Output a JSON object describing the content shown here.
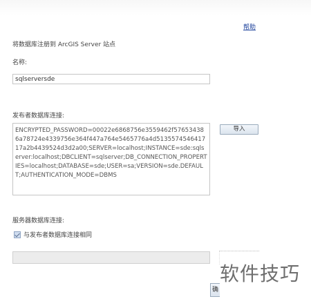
{
  "help_link": "帮助",
  "heading": "将数据库注册到 ArcGIS Server 站点",
  "name": {
    "label": "名称:",
    "value": "sqlserversde"
  },
  "publisher_connection": {
    "label": "发布者数据库连接:",
    "value": "ENCRYPTED_PASSWORD=00022e6868756e3559462f576534386a78724e4339756e364f447a764e5465776a4d513557454641717a2b4439524d3d2a00;SERVER=localhost;INSTANCE=sde:sqlserver:localhost;DBCLIENT=sqlserver;DB_CONNECTION_PROPERTIES=localhost;DATABASE=sde;USER=sa;VERSION=sde.DEFAULT;AUTHENTICATION_MODE=DBMS",
    "import_button": "导入"
  },
  "server_connection": {
    "label": "服务器数据库连接:",
    "same_as_publisher_label": "与发布者数据库连接相同",
    "same_as_publisher_checked": true,
    "value": ""
  },
  "cut_button_label": "确",
  "watermark": "软件技巧"
}
